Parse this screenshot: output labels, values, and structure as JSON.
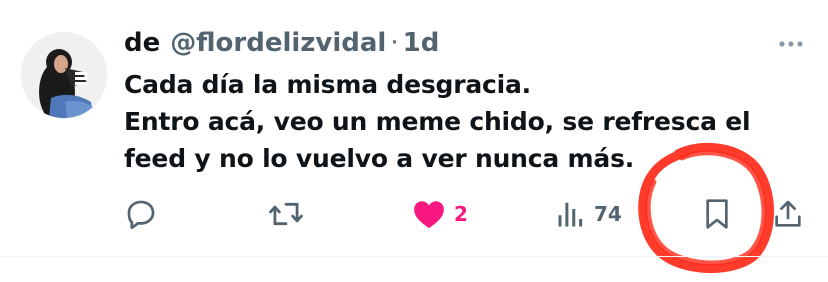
{
  "tweet": {
    "author_name": "de",
    "handle": "@flordelizvidal",
    "separator": "·",
    "time": "1d",
    "text": "Cada día la misma desgracia.\nEntro acá, veo un meme chido, se refresca el\nfeed y no lo vuelvo a ver nunca más."
  },
  "actions": {
    "reply": {
      "icon": "reply-icon"
    },
    "retweet": {
      "icon": "retweet-icon"
    },
    "like": {
      "icon": "heart-icon",
      "count": "2",
      "liked": true
    },
    "views": {
      "icon": "views-icon",
      "count": "74"
    },
    "bookmark": {
      "icon": "bookmark-icon"
    },
    "share": {
      "icon": "share-icon"
    }
  },
  "colors": {
    "text": "#0f1419",
    "secondary": "#536471",
    "like": "#f91880",
    "annotation": "#ff2a1a"
  }
}
